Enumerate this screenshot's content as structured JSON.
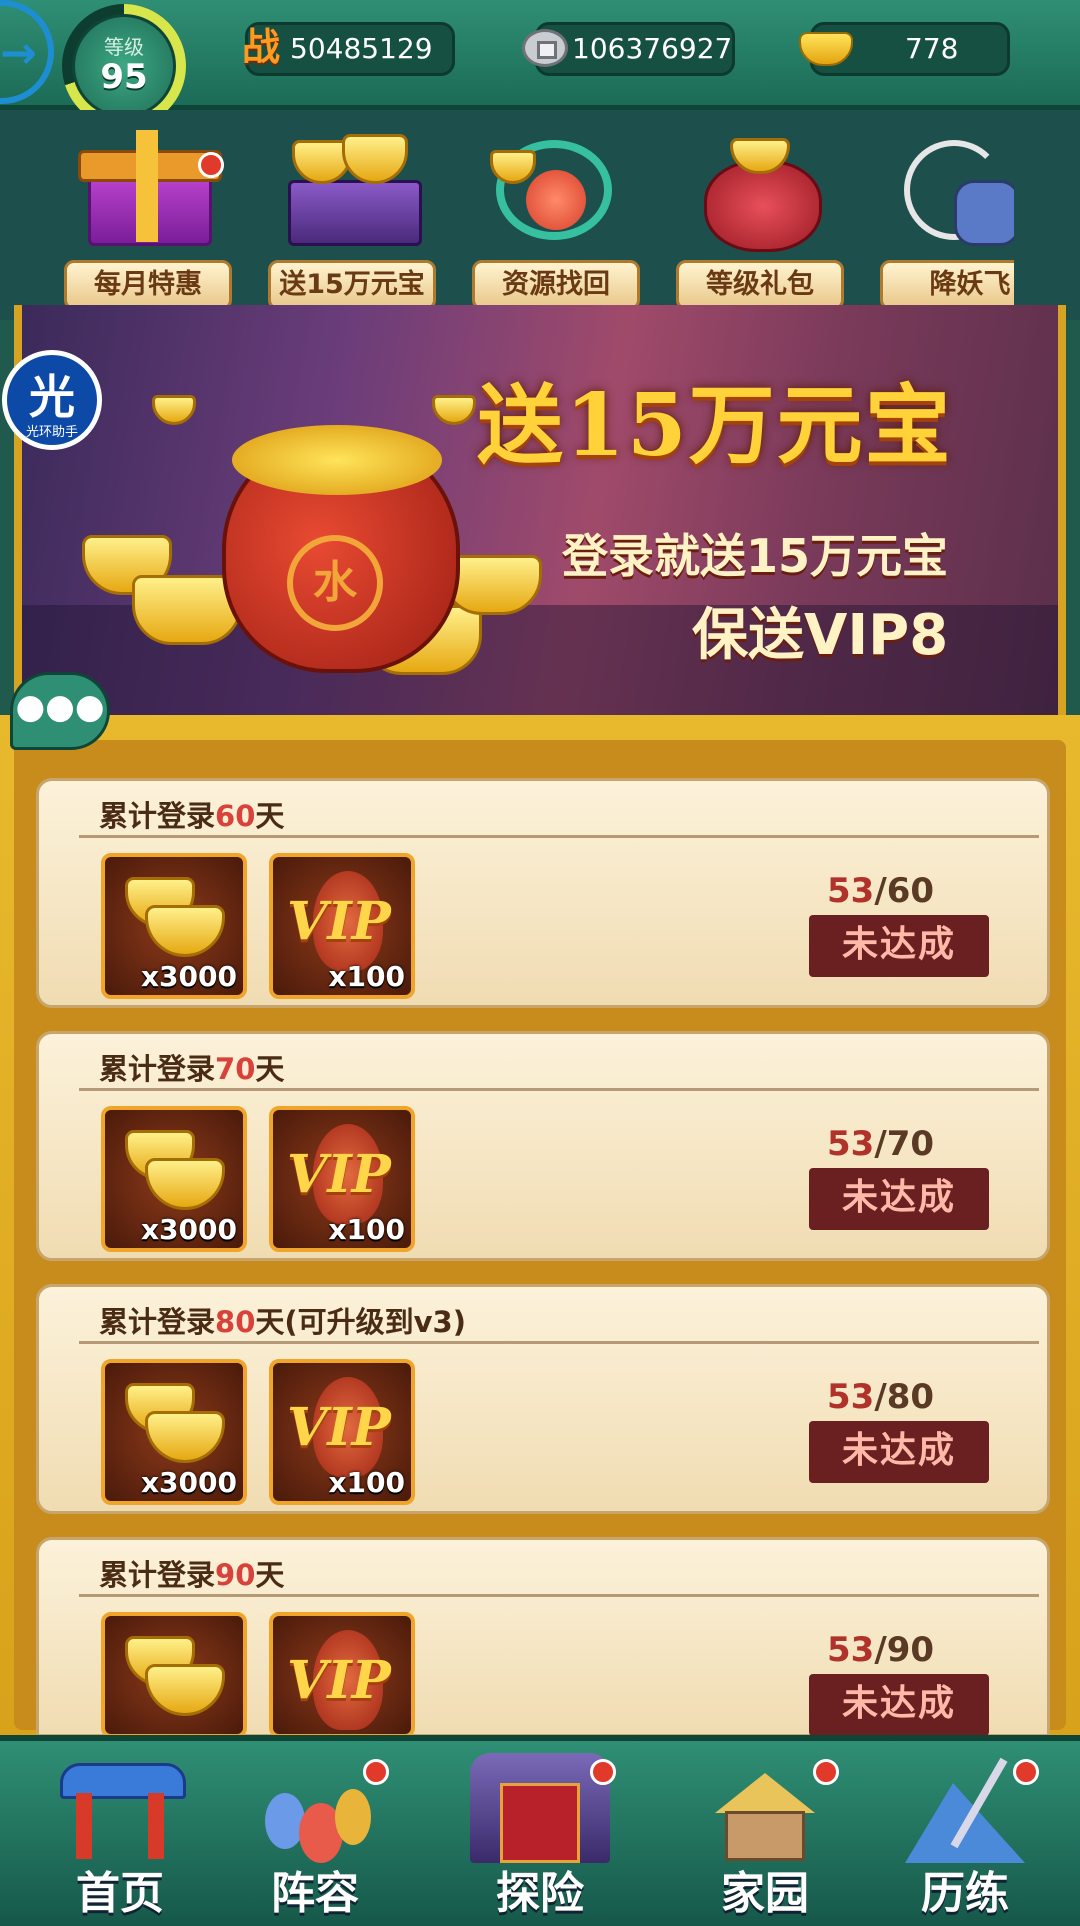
{
  "header": {
    "level_label": "等级",
    "level": "95",
    "power_icon": "战",
    "power": "50485129",
    "silver": "106376927",
    "gold_ingots": "778"
  },
  "activities": [
    {
      "label": "每月特惠",
      "has_dot": true,
      "icon": "gift-box-icon"
    },
    {
      "label": "送15万元宝",
      "has_dot": false,
      "icon": "gold-chest-icon"
    },
    {
      "label": "资源找回",
      "has_dot": false,
      "icon": "resource-recover-icon"
    },
    {
      "label": "等级礼包",
      "has_dot": false,
      "icon": "treasure-bag-icon"
    },
    {
      "label": "降妖飞",
      "has_dot": false,
      "icon": "demon-slayer-icon"
    }
  ],
  "banner": {
    "title": "送15万元宝",
    "line1": "登录就送15万元宝",
    "line2": "保送VIP8",
    "bag_emblem": "水"
  },
  "overlay_badge": {
    "char": "光",
    "text": "光环助手"
  },
  "rewards": [
    {
      "title_prefix": "累计登录",
      "days": "60",
      "title_suffix": "天",
      "gold_count": "x3000",
      "vip_count": "x100",
      "progress_current": "53",
      "progress_total": "60",
      "status": "未达成"
    },
    {
      "title_prefix": "累计登录",
      "days": "70",
      "title_suffix": "天",
      "gold_count": "x3000",
      "vip_count": "x100",
      "progress_current": "53",
      "progress_total": "70",
      "status": "未达成"
    },
    {
      "title_prefix": "累计登录",
      "days": "80",
      "title_suffix": "天(可升级到v3)",
      "gold_count": "x3000",
      "vip_count": "x100",
      "progress_current": "53",
      "progress_total": "80",
      "status": "未达成"
    },
    {
      "title_prefix": "累计登录",
      "days": "90",
      "title_suffix": "天",
      "gold_count": "",
      "vip_count": "",
      "progress_current": "53",
      "progress_total": "90",
      "status": "未达成"
    }
  ],
  "vip_label": "VIP",
  "nav": [
    {
      "label": "首页",
      "has_dot": false
    },
    {
      "label": "阵容",
      "has_dot": true
    },
    {
      "label": "探险",
      "has_dot": true
    },
    {
      "label": "家园",
      "has_dot": true
    },
    {
      "label": "历练",
      "has_dot": true
    }
  ],
  "colors": {
    "accent_red": "#d8423a",
    "gold": "#ffd23a",
    "teal": "#2f8f74"
  }
}
